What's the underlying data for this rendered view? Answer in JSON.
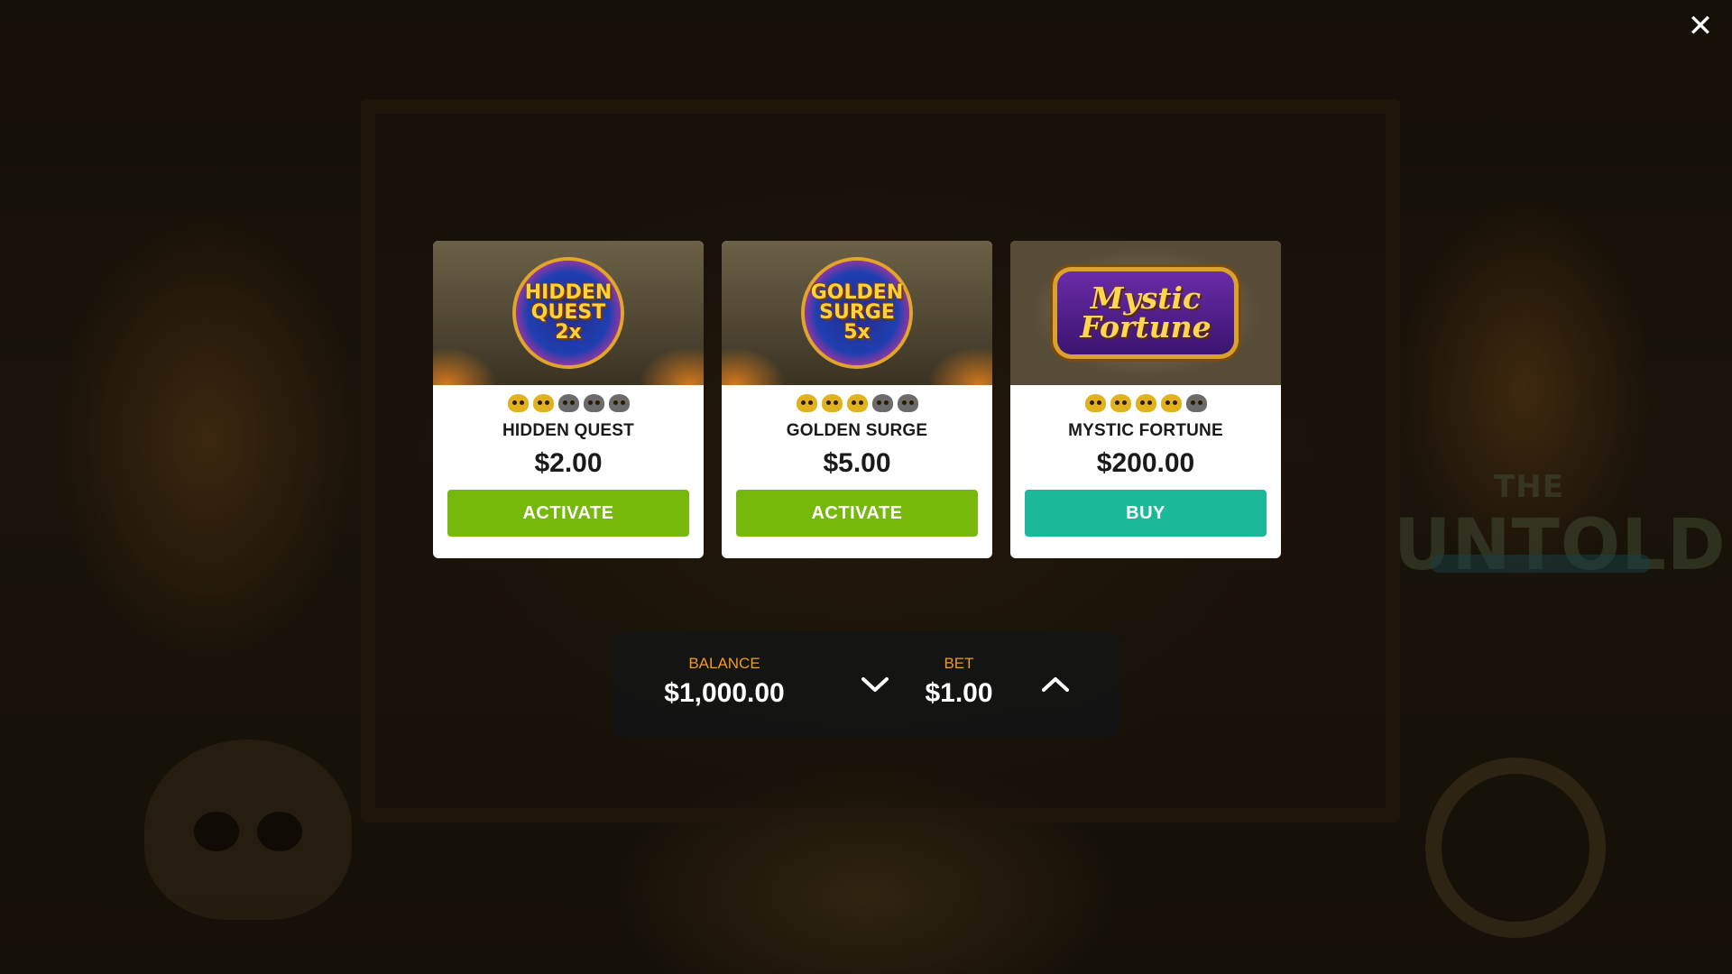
{
  "window": {
    "close_label": "✕"
  },
  "background": {
    "logo_small": "THE",
    "logo_text": "UNTOLD"
  },
  "offers": [
    {
      "badge_text": "HIDDEN\nQUEST\n2x",
      "image_icon": "hidden-quest-badge",
      "rating": 2,
      "rating_max": 5,
      "title": "HIDDEN QUEST",
      "price": "$2.00",
      "button_label": "ACTIVATE",
      "button_color": "#76b80c"
    },
    {
      "badge_text": "GOLDEN\nSURGE\n5x",
      "image_icon": "golden-surge-badge",
      "rating": 3,
      "rating_max": 5,
      "title": "GOLDEN SURGE",
      "price": "$5.00",
      "button_label": "ACTIVATE",
      "button_color": "#76b80c"
    },
    {
      "badge_text": "Mystic\nFortune",
      "image_icon": "mystic-fortune-plaque",
      "rating": 4,
      "rating_max": 5,
      "title": "MYSTIC FORTUNE",
      "price": "$200.00",
      "button_label": "BUY",
      "button_color": "#1bb89a"
    }
  ],
  "footer": {
    "balance_label": "BALANCE",
    "balance_value": "$1,000.00",
    "bet_label": "BET",
    "bet_value": "$1.00"
  },
  "colors": {
    "accent_orange": "#f29a1a",
    "skull_active": "#e2b21e",
    "skull_inactive": "#6b6b6b"
  }
}
